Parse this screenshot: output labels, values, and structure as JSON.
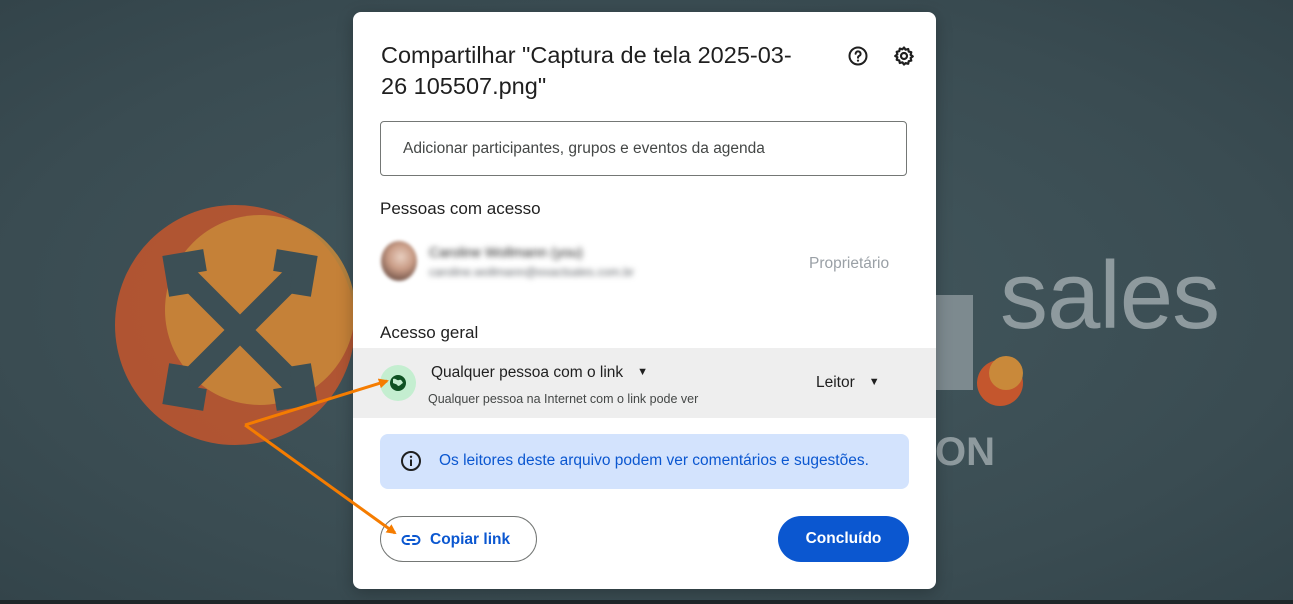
{
  "dialog": {
    "title": "Compartilhar \"Captura de tela 2025-03-26 105507.png\"",
    "help_icon": "help-circle-icon",
    "settings_icon": "gear-icon",
    "add_people_placeholder": "Adicionar participantes, grupos e eventos da agenda",
    "people_heading": "Pessoas com acesso",
    "person": {
      "name": "Caroline Wollmann (you)",
      "email": "caroline.wollmann@exactsales.com.br",
      "role": "Proprietário"
    },
    "general_access_heading": "Acesso geral",
    "general_access": {
      "icon": "globe-icon",
      "option": "Qualquer pessoa com o link",
      "description": "Qualquer pessoa na Internet com o link pode ver",
      "role": "Leitor"
    },
    "info_banner": {
      "icon": "info-icon",
      "text": "Os leitores deste arquivo podem ver comentários e sugestões."
    },
    "copy_link_label": "Copiar link",
    "copy_link_icon": "link-icon",
    "done_label": "Concluído"
  },
  "background": {
    "brand_suffix": "sales",
    "brand_partial": "ON"
  },
  "colors": {
    "primary": "#0b57d0",
    "banner": "#d3e3fd",
    "annotation_arrow": "#f57c00",
    "backdrop": "#3c4f55"
  }
}
